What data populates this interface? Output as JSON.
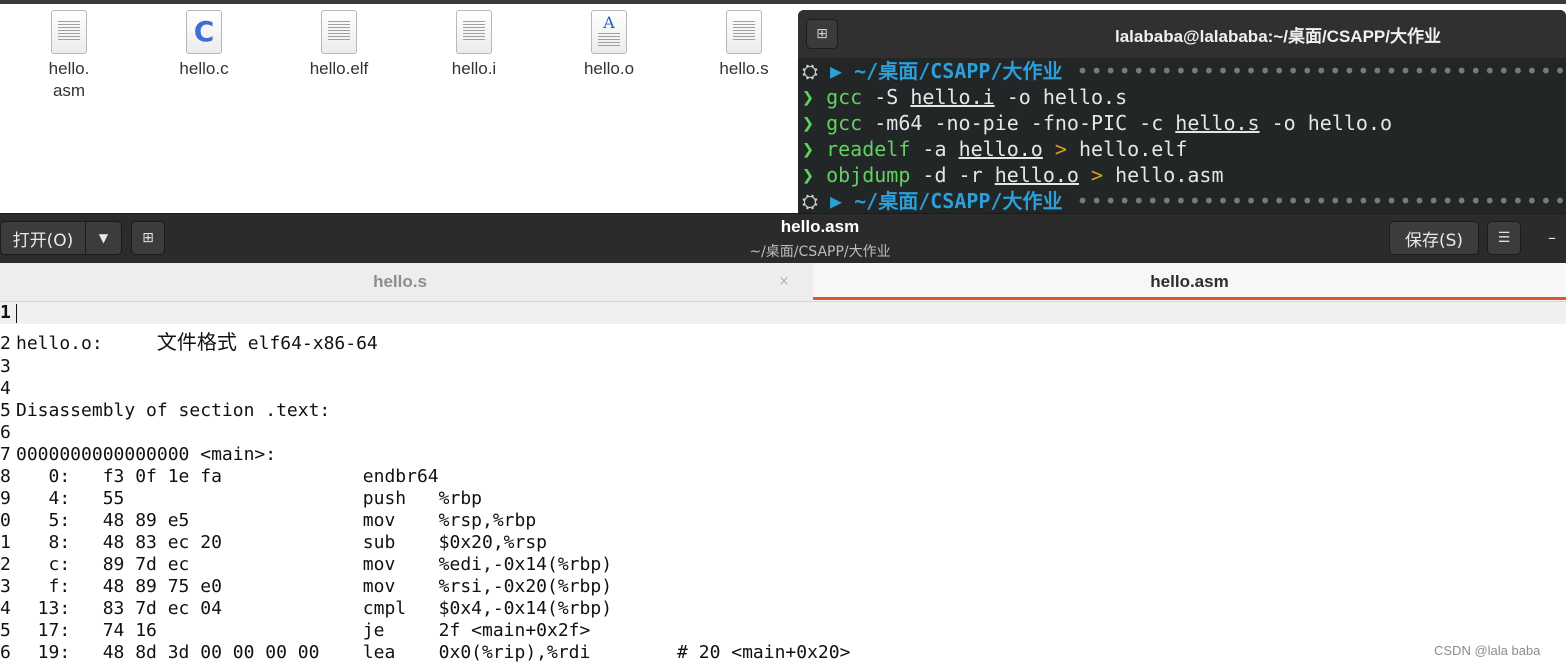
{
  "files": [
    {
      "name": "hello.\nasm",
      "kind": "text"
    },
    {
      "name": "hello.c",
      "kind": "c"
    },
    {
      "name": "hello.elf",
      "kind": "text"
    },
    {
      "name": "hello.i",
      "kind": "text"
    },
    {
      "name": "hello.o",
      "kind": "doc"
    },
    {
      "name": "hello.s",
      "kind": "text"
    }
  ],
  "terminal": {
    "title": "lalababa@lalababa:~/桌面/CSAPP/大作业",
    "prompt_path": "~/桌面/CSAPP/大作业",
    "prompt_dots": "••••••••••••••••••••••••••••••••••••••••••••••",
    "commands": [
      {
        "cmd": "gcc",
        "args": [
          " -S ",
          "hello.i",
          " -o hello.s"
        ]
      },
      {
        "cmd": "gcc",
        "args": [
          " -m64 -no-pie -fno-PIC -c ",
          "hello.s",
          " -o hello.o"
        ]
      },
      {
        "cmd": "readelf",
        "args": [
          " -a ",
          "hello.o",
          " ",
          ">",
          " hello.elf"
        ]
      },
      {
        "cmd": "objdump",
        "args": [
          " -d -r ",
          "hello.o",
          " ",
          ">",
          " hello.asm"
        ]
      }
    ]
  },
  "editor": {
    "open_label": "打开(O)",
    "title": "hello.asm",
    "subtitle": "~/桌面/CSAPP/大作业",
    "save_label": "保存(S)",
    "tabs": [
      {
        "label": "hello.s",
        "active": false
      },
      {
        "label": "hello.asm",
        "active": true
      }
    ],
    "lines": [
      {
        "n": "1",
        "text": ""
      },
      {
        "n": "2",
        "text": "hello.o:     文件格式 elf64-x86-64"
      },
      {
        "n": "3",
        "text": ""
      },
      {
        "n": "4",
        "text": ""
      },
      {
        "n": "5",
        "text": "Disassembly of section .text:"
      },
      {
        "n": "6",
        "text": ""
      },
      {
        "n": "7",
        "text": "0000000000000000 <main>:"
      },
      {
        "n": "8",
        "text": "   0:\tf3 0f 1e fa          \tendbr64 "
      },
      {
        "n": "9",
        "text": "   4:\t55                   \tpush   %rbp"
      },
      {
        "n": "0",
        "text": "   5:\t48 89 e5             \tmov    %rsp,%rbp"
      },
      {
        "n": "1",
        "text": "   8:\t48 83 ec 20          \tsub    $0x20,%rsp"
      },
      {
        "n": "2",
        "text": "   c:\t89 7d ec             \tmov    %edi,-0x14(%rbp)"
      },
      {
        "n": "3",
        "text": "   f:\t48 89 75 e0          \tmov    %rsi,-0x20(%rbp)"
      },
      {
        "n": "4",
        "text": "  13:\t83 7d ec 04          \tcmpl   $0x4,-0x14(%rbp)"
      },
      {
        "n": "5",
        "text": "  17:\t74 16                \tje     2f <main+0x2f>"
      },
      {
        "n": "6",
        "text": "  19:\t48 8d 3d 00 00 00 00 \tlea    0x0(%rip),%rdi        # 20 <main+0x20>"
      }
    ]
  },
  "watermark": "CSDN @lala baba"
}
